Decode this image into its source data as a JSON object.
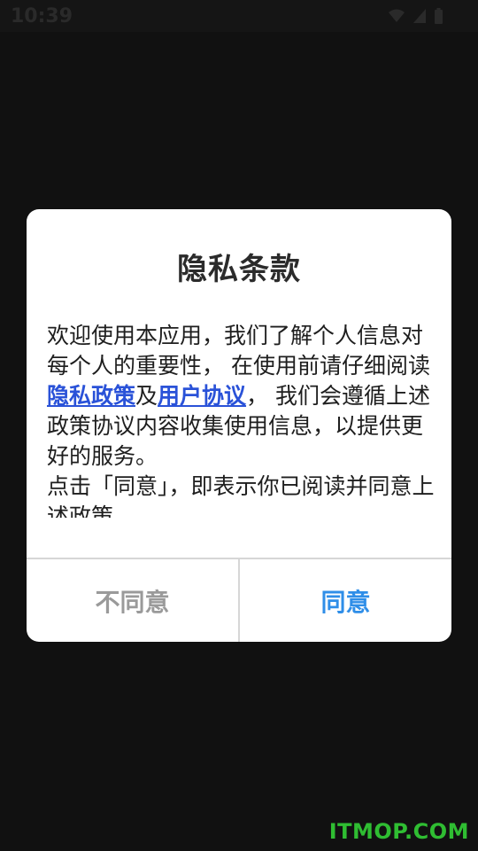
{
  "status_bar": {
    "time": "10:39",
    "icons": [
      "wifi-icon",
      "signal-icon",
      "battery-icon"
    ]
  },
  "dialog": {
    "title": "隐私条款",
    "body": {
      "part1": "欢迎使用本应用，我们了解个人信息对每个人的重要性， 在使用前请仔细阅读",
      "privacy_link": "隐私政策",
      "and": "及",
      "user_agreement_link": "用户协议",
      "part2": "， 我们会遵循上述政策协议内容收集使用信息，以提供更好的服务。",
      "part3": "点击「同意」，即表示你已阅读并同意上述政策"
    },
    "disagree_label": "不同意",
    "agree_label": "同意"
  },
  "watermark": "ITMOP.COM",
  "colors": {
    "link": "#2a52d8",
    "agree": "#2f8ee8",
    "disagree": "#9a9a9a",
    "watermark": "#2fbd32"
  }
}
